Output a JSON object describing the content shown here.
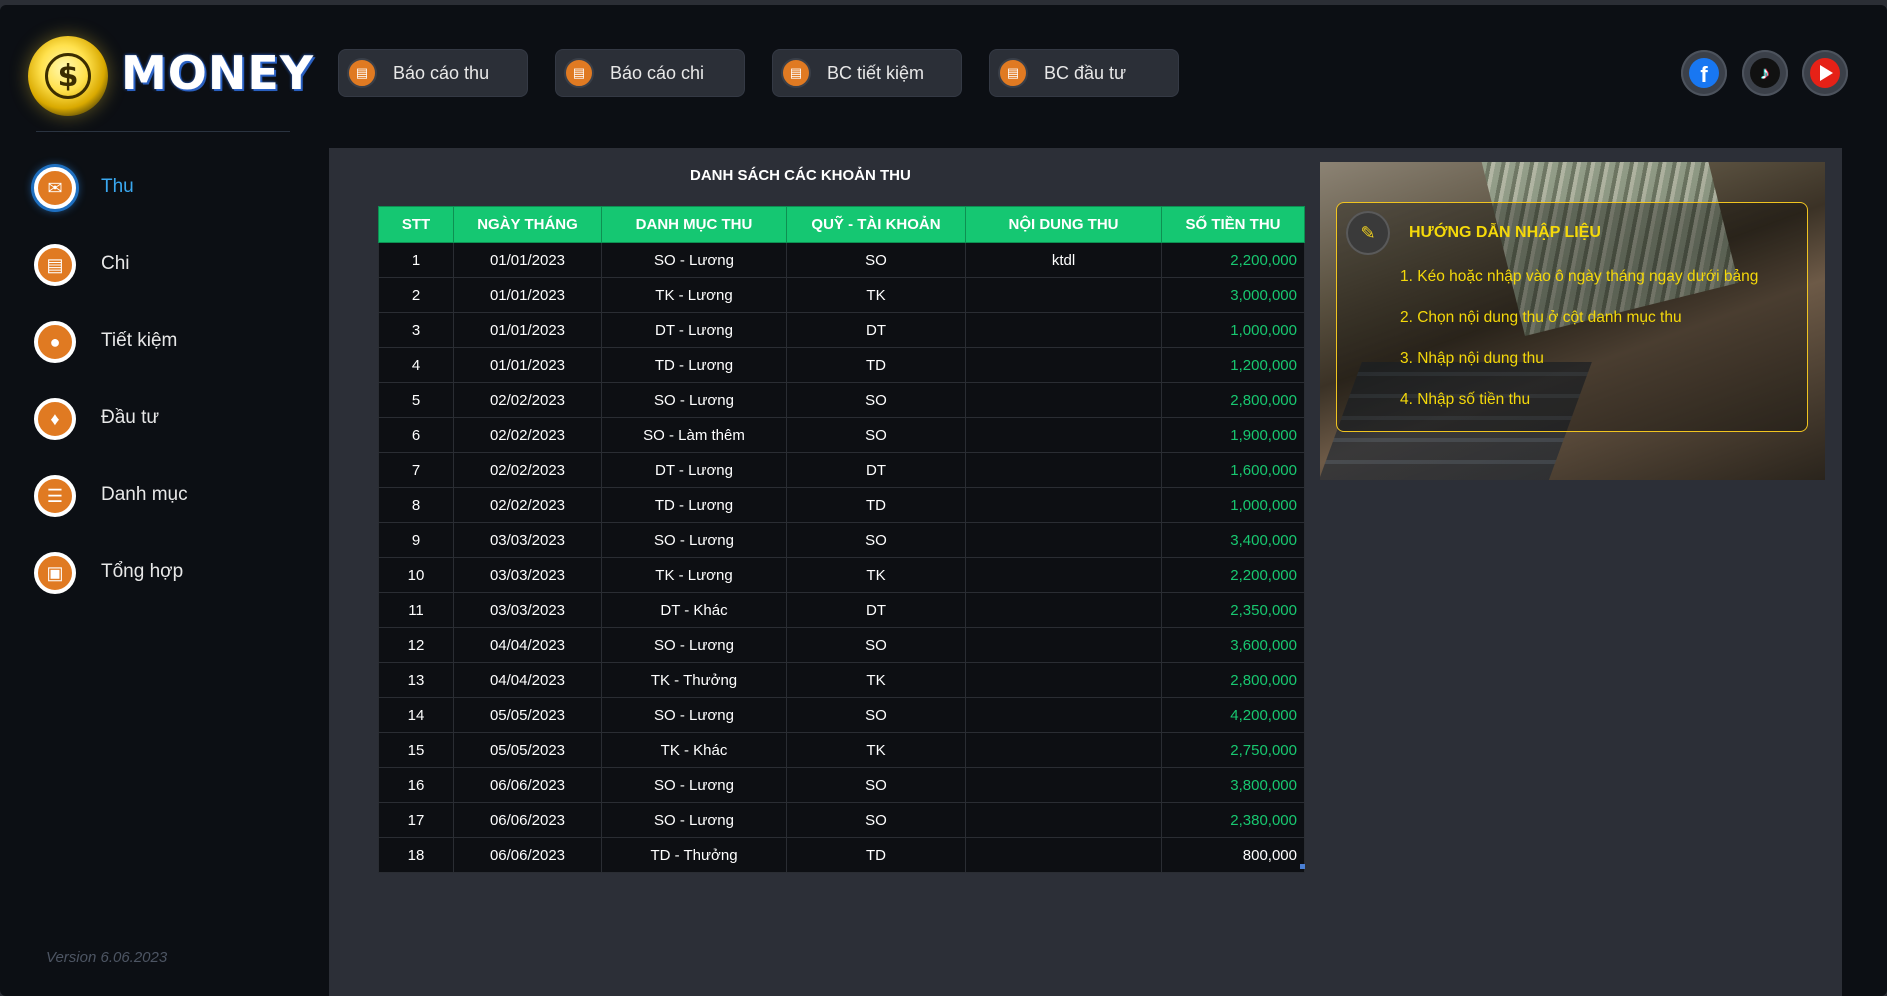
{
  "app": {
    "brand": "MONEY",
    "coin_symbol": "$",
    "version": "Version 6.06.2023"
  },
  "sidebar": {
    "items": [
      {
        "label": "Thu",
        "icon": "income-icon",
        "active": true
      },
      {
        "label": "Chi",
        "icon": "expense-icon",
        "active": false
      },
      {
        "label": "Tiết kiệm",
        "icon": "piggy-bank-icon",
        "active": false
      },
      {
        "label": "Đầu tư",
        "icon": "investment-icon",
        "active": false
      },
      {
        "label": "Danh mục",
        "icon": "clipboard-icon",
        "active": false
      },
      {
        "label": "Tổng hợp",
        "icon": "summary-icon",
        "active": false
      }
    ]
  },
  "toolbar": {
    "reports": [
      {
        "label": "Báo cáo thu",
        "icon": "report-icon"
      },
      {
        "label": "Báo cáo chi",
        "icon": "report-icon"
      },
      {
        "label": "BC tiết kiệm",
        "icon": "report-icon"
      },
      {
        "label": "BC đầu tư",
        "icon": "report-icon"
      }
    ],
    "social": [
      "facebook-icon",
      "tiktok-icon",
      "youtube-icon"
    ],
    "facebook_glyph": "f",
    "tiktok_glyph": "♪"
  },
  "table": {
    "title": "DANH SÁCH CÁC KHOẢN THU",
    "headers": [
      "STT",
      "NGÀY THÁNG",
      "DANH MỤC THU",
      "QUỸ - TÀI KHOẢN",
      "NỘI DUNG THU",
      "SỐ TIỀN THU"
    ],
    "rows": [
      [
        "1",
        "01/01/2023",
        "SO - Lương",
        "SO",
        "ktdl",
        "2,200,000"
      ],
      [
        "2",
        "01/01/2023",
        "TK - Lương",
        "TK",
        "",
        "3,000,000"
      ],
      [
        "3",
        "01/01/2023",
        "DT - Lương",
        "DT",
        "",
        "1,000,000"
      ],
      [
        "4",
        "01/01/2023",
        "TD - Lương",
        "TD",
        "",
        "1,200,000"
      ],
      [
        "5",
        "02/02/2023",
        "SO - Lương",
        "SO",
        "",
        "2,800,000"
      ],
      [
        "6",
        "02/02/2023",
        "SO - Làm thêm",
        "SO",
        "",
        "1,900,000"
      ],
      [
        "7",
        "02/02/2023",
        "DT - Lương",
        "DT",
        "",
        "1,600,000"
      ],
      [
        "8",
        "02/02/2023",
        "TD - Lương",
        "TD",
        "",
        "1,000,000"
      ],
      [
        "9",
        "03/03/2023",
        "SO - Lương",
        "SO",
        "",
        "3,400,000"
      ],
      [
        "10",
        "03/03/2023",
        "TK - Lương",
        "TK",
        "",
        "2,200,000"
      ],
      [
        "11",
        "03/03/2023",
        "DT - Khác",
        "DT",
        "",
        "2,350,000"
      ],
      [
        "12",
        "04/04/2023",
        "SO - Lương",
        "SO",
        "",
        "3,600,000"
      ],
      [
        "13",
        "04/04/2023",
        "TK - Thưởng",
        "TK",
        "",
        "2,800,000"
      ],
      [
        "14",
        "05/05/2023",
        "SO - Lương",
        "SO",
        "",
        "4,200,000"
      ],
      [
        "15",
        "05/05/2023",
        "TK - Khác",
        "TK",
        "",
        "2,750,000"
      ],
      [
        "16",
        "06/06/2023",
        "SO - Lương",
        "SO",
        "",
        "3,800,000"
      ],
      [
        "17",
        "06/06/2023",
        "SO - Lương",
        "SO",
        "",
        "2,380,000"
      ],
      [
        "18",
        "06/06/2023",
        "TD - Thưởng",
        "TD",
        "",
        "800,000"
      ]
    ],
    "last_row_amount_plain": true
  },
  "guide": {
    "title": "HƯỚNG DẪN NHẬP LIỆU",
    "icon": "edit-note-icon",
    "steps": [
      "1. Kéo hoặc nhập vào ô ngày tháng ngay dưới bảng",
      "2. Chọn nội dung thu ở cột danh mục thu",
      "3. Nhập nội dung thu",
      "4. Nhập số tiền thu"
    ]
  },
  "colors": {
    "accent_green": "#15c772",
    "amount_green": "#18c870",
    "active_blue": "#3aa8f0",
    "icon_orange": "#e07a22",
    "guide_yellow": "#f5d90a"
  }
}
